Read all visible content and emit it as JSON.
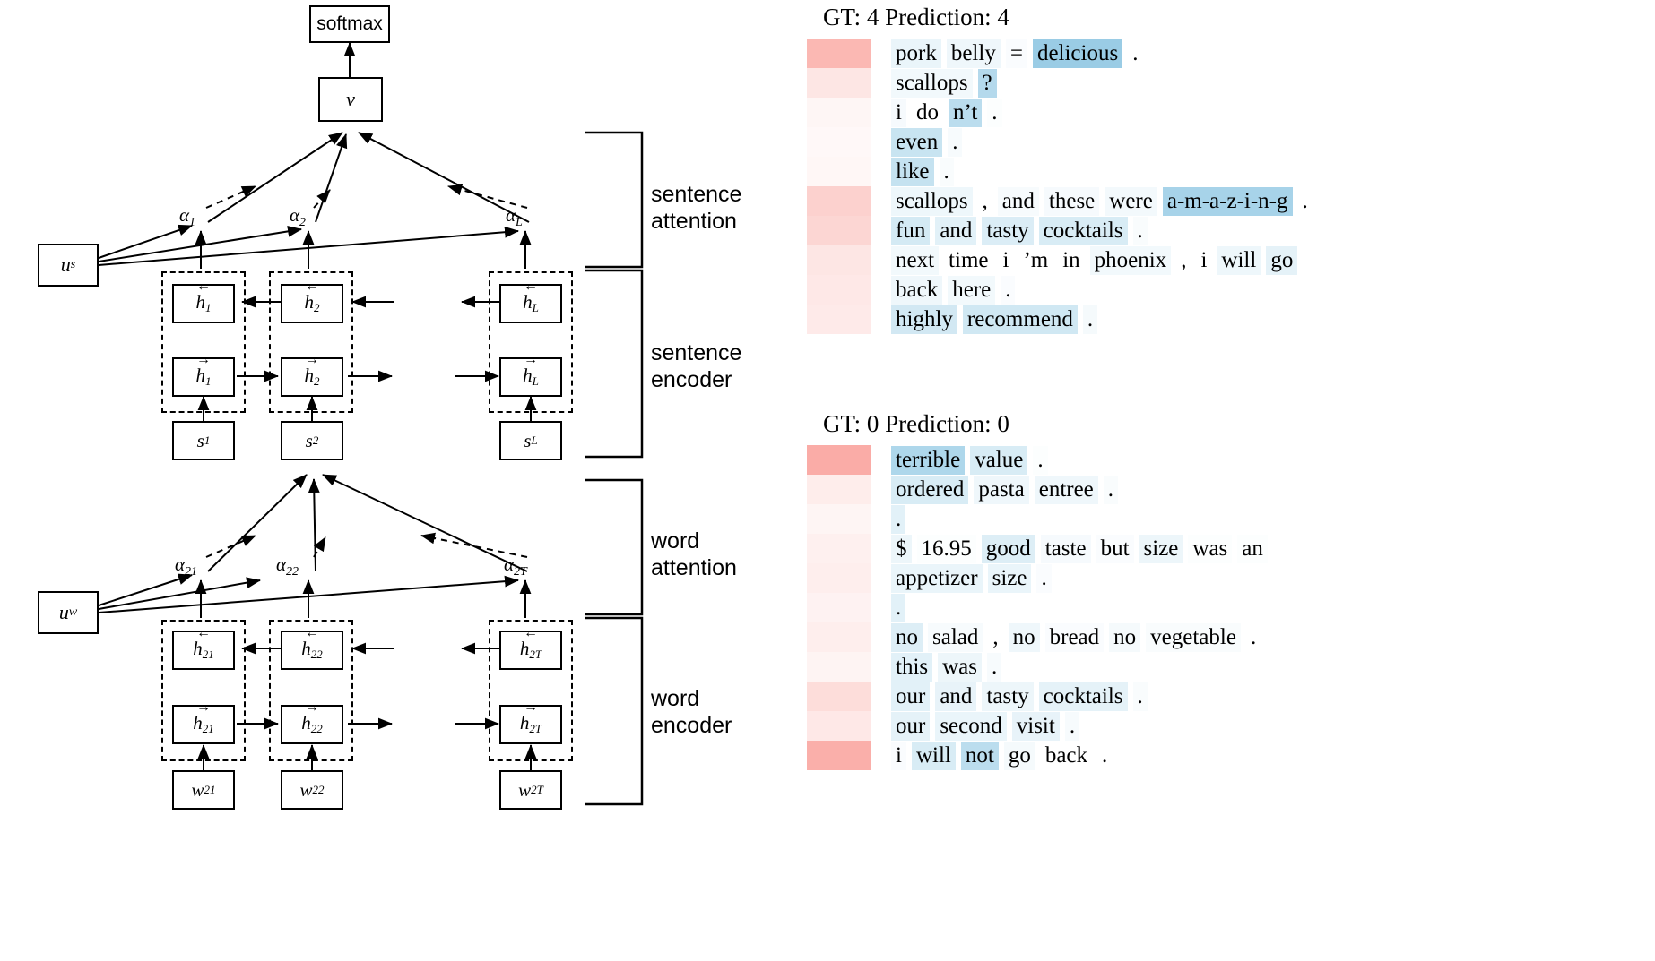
{
  "figure": {
    "left_panel_name": "hierarchical-attention-network-architecture",
    "right_panel_name": "attention-visualization"
  },
  "diagram": {
    "nodes": {
      "softmax": "softmax",
      "v": "v",
      "u_s": "u",
      "u_s_sub": "s",
      "u_w": "u",
      "u_w_sub": "w",
      "s1": "s",
      "s1_sub": "1",
      "s2": "s",
      "s2_sub": "2",
      "sL": "s",
      "sL_sub": "L",
      "w21": "w",
      "w21_sub": "21",
      "w22": "w",
      "w22_sub": "22",
      "w2T": "w",
      "w2T_sub": "2T",
      "h_back_1": "h",
      "h_back_1_sub": "1",
      "h_back_2": "h",
      "h_back_2_sub": "2",
      "h_back_L": "h",
      "h_back_L_sub": "L",
      "h_fwd_1": "h",
      "h_fwd_1_sub": "1",
      "h_fwd_2": "h",
      "h_fwd_2_sub": "2",
      "h_fwd_L": "h",
      "h_fwd_L_sub": "L",
      "h_back_21": "h",
      "h_back_21_sub": "21",
      "h_back_22": "h",
      "h_back_22_sub": "22",
      "h_back_2T": "h",
      "h_back_2T_sub": "2T",
      "h_fwd_21": "h",
      "h_fwd_21_sub": "21",
      "h_fwd_22": "h",
      "h_fwd_22_sub": "22",
      "h_fwd_2T": "h",
      "h_fwd_2T_sub": "2T"
    },
    "alphas": {
      "a1": "α",
      "a1_sub": "1",
      "a2": "α",
      "a2_sub": "2",
      "aL": "α",
      "aL_sub": "L",
      "a21": "α",
      "a21_sub": "21",
      "a22": "α",
      "a22_sub": "22",
      "a2T": "α",
      "a2T_sub": "2T"
    },
    "side_labels": {
      "sentence_attention": "sentence\nattention",
      "sentence_encoder": "sentence\nencoder",
      "word_attention": "word\nattention",
      "word_encoder": "word\nencoder"
    }
  },
  "visualization": {
    "colors": {
      "sentence_attention_hue": "#f4a6a0",
      "word_attention_hue": "#8ec7e0",
      "text": "#000000",
      "background": "#ffffff"
    },
    "examples": [
      {
        "title": "GT: 4 Prediction: 4",
        "ground_truth": 4,
        "prediction": 4,
        "sentences": [
          {
            "sentence_weight": 0.62,
            "words": [
              {
                "text": "pork",
                "weight": 0.16
              },
              {
                "text": "belly",
                "weight": 0.12
              },
              {
                "text": "=",
                "weight": 0.04
              },
              {
                "text": "delicious",
                "weight": 0.78
              },
              {
                "text": ".",
                "weight": 0.0
              }
            ]
          },
          {
            "sentence_weight": 0.22,
            "words": [
              {
                "text": "scallops",
                "weight": 0.1
              },
              {
                "text": "?",
                "weight": 0.58
              }
            ]
          },
          {
            "sentence_weight": 0.08,
            "words": [
              {
                "text": "i",
                "weight": 0.07
              },
              {
                "text": "do",
                "weight": 0.0
              },
              {
                "text": "n’t",
                "weight": 0.52
              },
              {
                "text": ".",
                "weight": 0.02
              }
            ]
          },
          {
            "sentence_weight": 0.06,
            "words": [
              {
                "text": "even",
                "weight": 0.42
              },
              {
                "text": ".",
                "weight": 0.06
              }
            ]
          },
          {
            "sentence_weight": 0.07,
            "words": [
              {
                "text": "like",
                "weight": 0.45
              },
              {
                "text": ".",
                "weight": 0.05
              }
            ]
          },
          {
            "sentence_weight": 0.4,
            "words": [
              {
                "text": "scallops",
                "weight": 0.13
              },
              {
                "text": ",",
                "weight": 0.0
              },
              {
                "text": "and",
                "weight": 0.06
              },
              {
                "text": "these",
                "weight": 0.07
              },
              {
                "text": "were",
                "weight": 0.09
              },
              {
                "text": "a-m-a-z-i-n-g",
                "weight": 0.68
              },
              {
                "text": ".",
                "weight": 0.0
              }
            ]
          },
          {
            "sentence_weight": 0.36,
            "words": [
              {
                "text": "fun",
                "weight": 0.33
              },
              {
                "text": "and",
                "weight": 0.22
              },
              {
                "text": "tasty",
                "weight": 0.28
              },
              {
                "text": "cocktails",
                "weight": 0.3
              },
              {
                "text": ".",
                "weight": 0.05
              }
            ]
          },
          {
            "sentence_weight": 0.22,
            "words": [
              {
                "text": "next",
                "weight": 0.1
              },
              {
                "text": "time",
                "weight": 0.0
              },
              {
                "text": "i",
                "weight": 0.0
              },
              {
                "text": "’m",
                "weight": 0.0
              },
              {
                "text": "in",
                "weight": 0.0
              },
              {
                "text": "phoenix",
                "weight": 0.1
              },
              {
                "text": ",",
                "weight": 0.0
              },
              {
                "text": "i",
                "weight": 0.0
              },
              {
                "text": "will",
                "weight": 0.13
              },
              {
                "text": "go",
                "weight": 0.2
              }
            ]
          },
          {
            "sentence_weight": 0.2,
            "words": [
              {
                "text": "back",
                "weight": 0.12
              },
              {
                "text": "here",
                "weight": 0.1
              },
              {
                "text": ".",
                "weight": 0.04
              }
            ]
          },
          {
            "sentence_weight": 0.18,
            "words": [
              {
                "text": "highly",
                "weight": 0.35
              },
              {
                "text": "recommend",
                "weight": 0.36
              },
              {
                "text": ".",
                "weight": 0.08
              }
            ]
          }
        ]
      },
      {
        "title": "GT: 0 Prediction: 0",
        "ground_truth": 0,
        "prediction": 0,
        "sentences": [
          {
            "sentence_weight": 0.72,
            "words": [
              {
                "text": "terrible",
                "weight": 0.62
              },
              {
                "text": "value",
                "weight": 0.3
              },
              {
                "text": ".",
                "weight": 0.02
              }
            ]
          },
          {
            "sentence_weight": 0.16,
            "words": [
              {
                "text": "ordered",
                "weight": 0.3
              },
              {
                "text": "pasta",
                "weight": 0.12
              },
              {
                "text": "entree",
                "weight": 0.12
              },
              {
                "text": ".",
                "weight": 0.05
              }
            ]
          },
          {
            "sentence_weight": 0.09,
            "words": [
              {
                "text": ".",
                "weight": 0.22
              }
            ]
          },
          {
            "sentence_weight": 0.13,
            "words": [
              {
                "text": "$",
                "weight": 0.14
              },
              {
                "text": "16.95",
                "weight": 0.02
              },
              {
                "text": "good",
                "weight": 0.26
              },
              {
                "text": "taste",
                "weight": 0.07
              },
              {
                "text": "but",
                "weight": 0.04
              },
              {
                "text": "size",
                "weight": 0.14
              },
              {
                "text": "was",
                "weight": 0.02
              },
              {
                "text": "an",
                "weight": 0.02
              }
            ]
          },
          {
            "sentence_weight": 0.15,
            "words": [
              {
                "text": "appetizer",
                "weight": 0.16
              },
              {
                "text": "size",
                "weight": 0.16
              },
              {
                "text": ".",
                "weight": 0.04
              }
            ]
          },
          {
            "sentence_weight": 0.11,
            "words": [
              {
                "text": ".",
                "weight": 0.22
              }
            ]
          },
          {
            "sentence_weight": 0.15,
            "words": [
              {
                "text": "no",
                "weight": 0.26
              },
              {
                "text": "salad",
                "weight": 0.06
              },
              {
                "text": ",",
                "weight": 0.0
              },
              {
                "text": "no",
                "weight": 0.12
              },
              {
                "text": "bread",
                "weight": 0.04
              },
              {
                "text": "no",
                "weight": 0.08
              },
              {
                "text": "vegetable",
                "weight": 0.05
              },
              {
                "text": ".",
                "weight": 0.0
              }
            ]
          },
          {
            "sentence_weight": 0.1,
            "words": [
              {
                "text": "this",
                "weight": 0.22
              },
              {
                "text": "was",
                "weight": 0.14
              },
              {
                "text": ".",
                "weight": 0.06
              }
            ]
          },
          {
            "sentence_weight": 0.3,
            "words": [
              {
                "text": "our",
                "weight": 0.22
              },
              {
                "text": "and",
                "weight": 0.18
              },
              {
                "text": "tasty",
                "weight": 0.14
              },
              {
                "text": "cocktails",
                "weight": 0.2
              },
              {
                "text": ".",
                "weight": 0.05
              }
            ]
          },
          {
            "sentence_weight": 0.2,
            "words": [
              {
                "text": "our",
                "weight": 0.2
              },
              {
                "text": "second",
                "weight": 0.16
              },
              {
                "text": "visit",
                "weight": 0.18
              },
              {
                "text": ".",
                "weight": 0.06
              }
            ]
          },
          {
            "sentence_weight": 0.7,
            "words": [
              {
                "text": "i",
                "weight": 0.04
              },
              {
                "text": "will",
                "weight": 0.3
              },
              {
                "text": "not",
                "weight": 0.52
              },
              {
                "text": "go",
                "weight": 0.08
              },
              {
                "text": "back",
                "weight": 0.0
              },
              {
                "text": ".",
                "weight": 0.0
              }
            ]
          }
        ]
      }
    ]
  }
}
